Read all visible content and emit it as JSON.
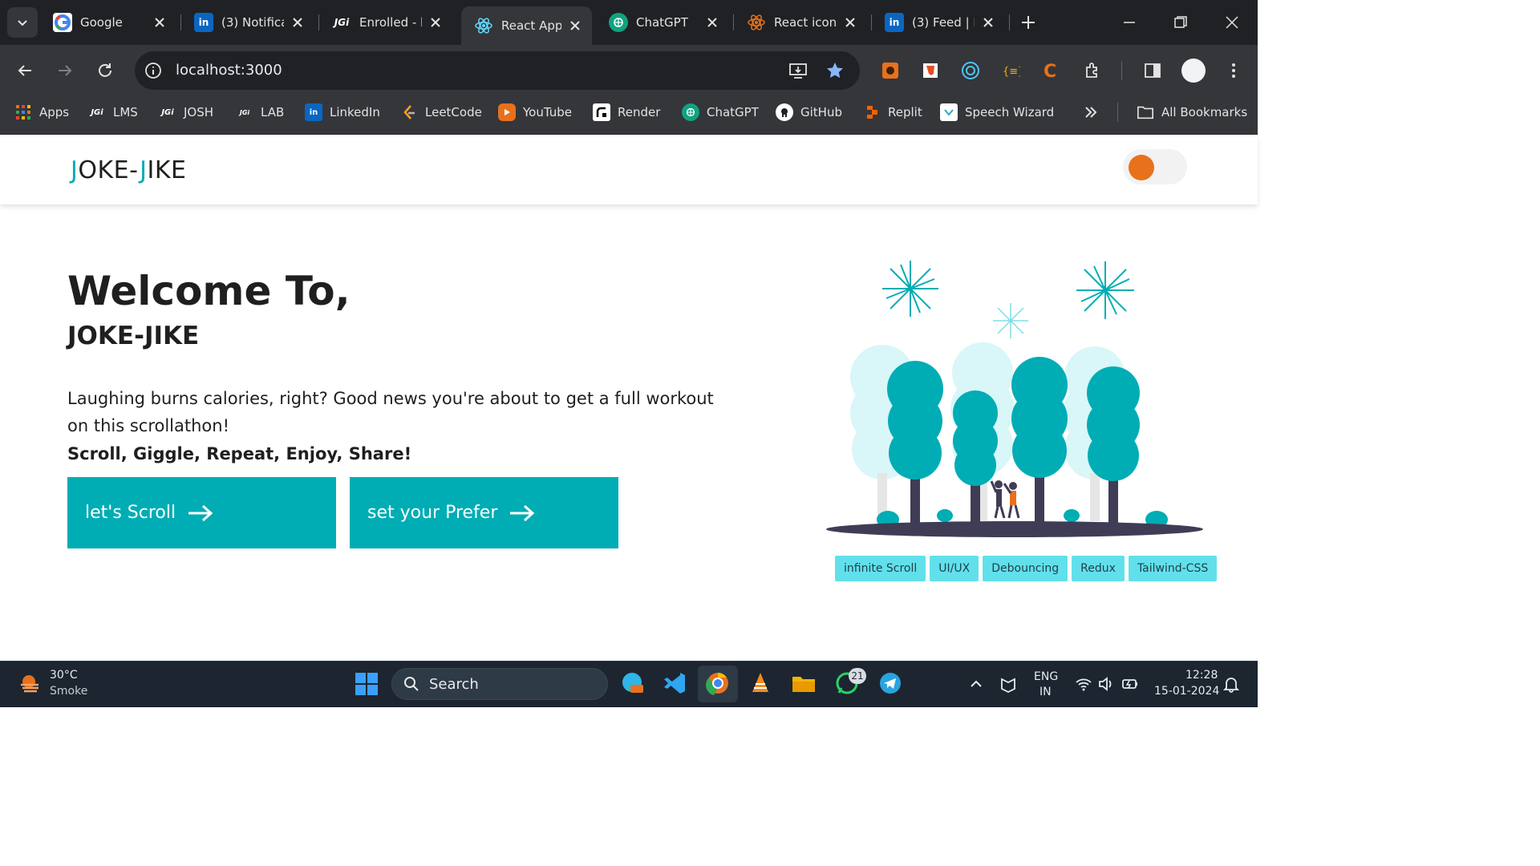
{
  "browser": {
    "tabs": [
      {
        "title": "Google",
        "icon": "google-icon",
        "left": 0
      },
      {
        "title": "(3) Notifica",
        "icon": "linkedin-icon"
      },
      {
        "title": "Enrolled - l",
        "icon": "jgi-icon"
      },
      {
        "title": "React App",
        "icon": "react-icon",
        "active": true
      },
      {
        "title": "ChatGPT",
        "icon": "chatgpt-icon"
      },
      {
        "title": "React icon",
        "icon": "react-icon"
      },
      {
        "title": "(3) Feed | L",
        "icon": "linkedin-icon"
      }
    ],
    "url": "localhost:3000",
    "bookmarks": [
      "Apps",
      "LMS",
      "JOSH",
      "LAB",
      "LinkedIn",
      "LeetCode",
      "YouTube",
      "Render",
      "ChatGPT",
      "GitHub",
      "Replit",
      "Speech Wizard"
    ],
    "all_bookmarks": "All Bookmarks"
  },
  "page": {
    "logo_j1": "J",
    "logo_mid": "OKE-",
    "logo_j2": "J",
    "logo_end": "IKE",
    "welcome": "Welcome To,",
    "subtitle": "JOKE-JIKE",
    "description": "Laughing burns calories, right? Good news you're about to get a full workout on this scrollathon!",
    "tagline": "Scroll, Giggle, Repeat, Enjoy, Share!",
    "buttons": {
      "scroll": "let's Scroll",
      "prefer": "set your Prefer"
    },
    "tags": [
      "infinite Scroll",
      "UI/UX",
      "Debouncing",
      "Redux",
      "Tailwind-CSS"
    ],
    "colors": {
      "accent": "#00adb5",
      "toggle_knob": "#e8711c",
      "tag_bg": "#61e0ec"
    }
  },
  "taskbar": {
    "temperature": "30°C",
    "weather": "Smoke",
    "search": "Search",
    "lang_top": "ENG",
    "lang_bottom": "IN",
    "time": "12:28",
    "date": "15-01-2024",
    "whatsapp_badge": "21"
  }
}
